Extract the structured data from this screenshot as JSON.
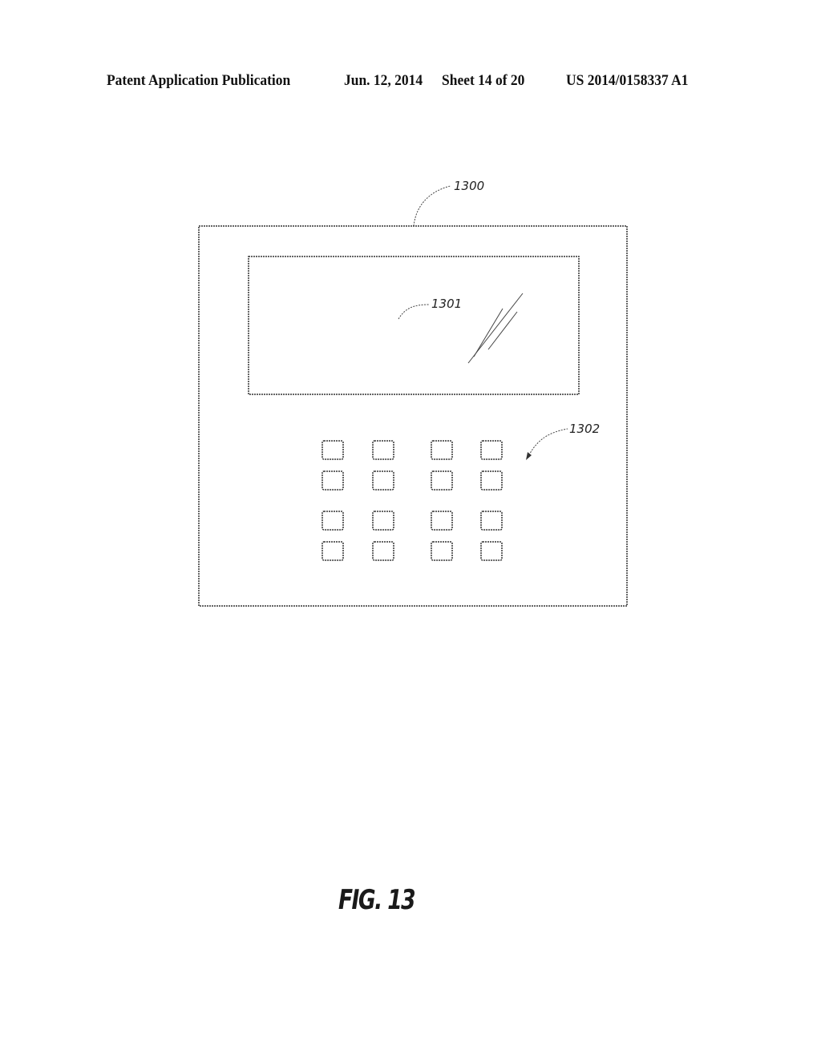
{
  "header": {
    "publication_type": "Patent Application Publication",
    "date": "Jun. 12, 2014",
    "sheet": "Sheet 14 of 20",
    "publication_number": "US 2014/0158337 A1"
  },
  "figure": {
    "label": "FIG. 13",
    "reference_numerals": {
      "device": "1300",
      "display": "1301",
      "keypad": "1302"
    },
    "keypad": {
      "rows": 4,
      "columns": 4
    }
  }
}
